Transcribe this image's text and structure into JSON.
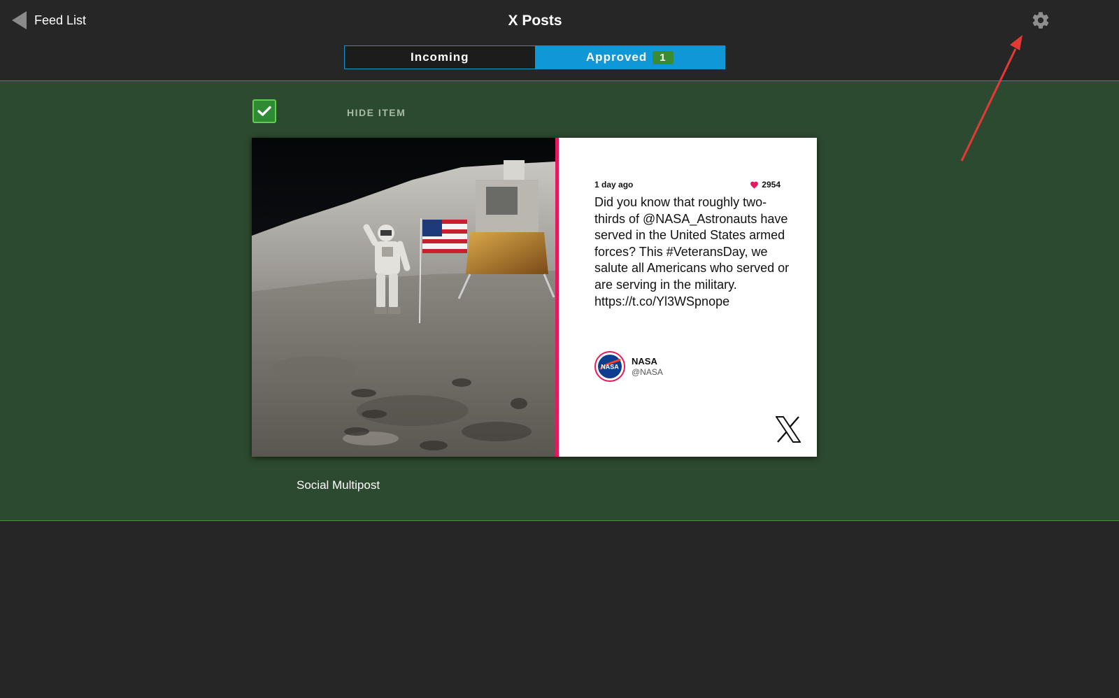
{
  "header": {
    "back_label": "Feed List",
    "title": "X Posts",
    "settings_icon": "gear-icon"
  },
  "tabs": [
    {
      "label": "Incoming",
      "active": false
    },
    {
      "label": "Approved",
      "active": true,
      "count": "1"
    }
  ],
  "item": {
    "checked": true,
    "hide_label": "HIDE ITEM",
    "caption": "Social Multipost"
  },
  "post": {
    "time_ago": "1 day ago",
    "likes": "2954",
    "text": "Did you know that roughly two-thirds of @NASA_Astronauts have served in the United States armed forces? This #VeteransDay, we salute all Americans who served or are serving in the military. https://t.co/Yl3WSpnope",
    "author_name": "NASA",
    "author_handle": "@NASA",
    "avatar_text": "NASA",
    "platform_icon": "x-logo-icon"
  },
  "colors": {
    "background": "#262626",
    "content_bg": "#2c4a2f",
    "accent_blue": "#0f97d8",
    "badge_green": "#3b8b33",
    "divider_pink": "#e6195e",
    "annotation_red": "#e53935"
  }
}
